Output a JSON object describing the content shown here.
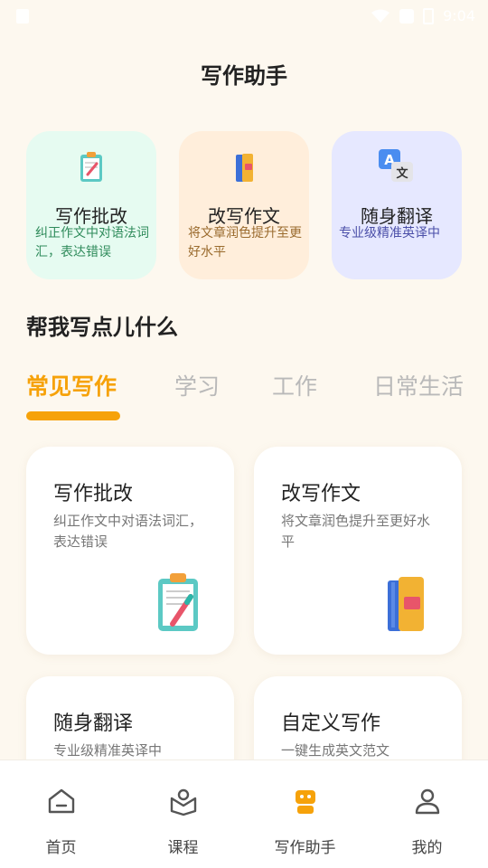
{
  "status_bar": {
    "time": "9:04"
  },
  "header": {
    "title": "写作助手"
  },
  "quick_actions": [
    {
      "title": "写作批改",
      "subtitle": "纠正作文中对语法词汇，表达错误",
      "icon": "clipboard-pen-icon"
    },
    {
      "title": "改写作文",
      "subtitle": "将文章润色提升至更好水平",
      "icon": "book-icon"
    },
    {
      "title": "随身翻译",
      "subtitle": "专业级精准英译中",
      "icon": "translate-icon"
    }
  ],
  "section": {
    "title": "帮我写点儿什么"
  },
  "tabs": [
    {
      "label": "常见写作",
      "active": true
    },
    {
      "label": "学习",
      "active": false
    },
    {
      "label": "工作",
      "active": false
    },
    {
      "label": "日常生活",
      "active": false
    }
  ],
  "cards": [
    {
      "title": "写作批改",
      "subtitle": "纠正作文中对语法词汇，表达错误",
      "icon": "clipboard-pen-icon"
    },
    {
      "title": "改写作文",
      "subtitle": "将文章润色提升至更好水平",
      "icon": "book-icon"
    },
    {
      "title": "随身翻译",
      "subtitle": "专业级精准英译中"
    },
    {
      "title": "自定义写作",
      "subtitle": "一键生成英文范文"
    }
  ],
  "bottom_nav": [
    {
      "label": "首页",
      "icon": "home-icon"
    },
    {
      "label": "课程",
      "icon": "course-icon"
    },
    {
      "label": "写作助手",
      "icon": "robot-icon",
      "active": true
    },
    {
      "label": "我的",
      "icon": "profile-icon"
    }
  ],
  "colors": {
    "accent": "#f6a20a",
    "background": "#fdf8ef"
  }
}
